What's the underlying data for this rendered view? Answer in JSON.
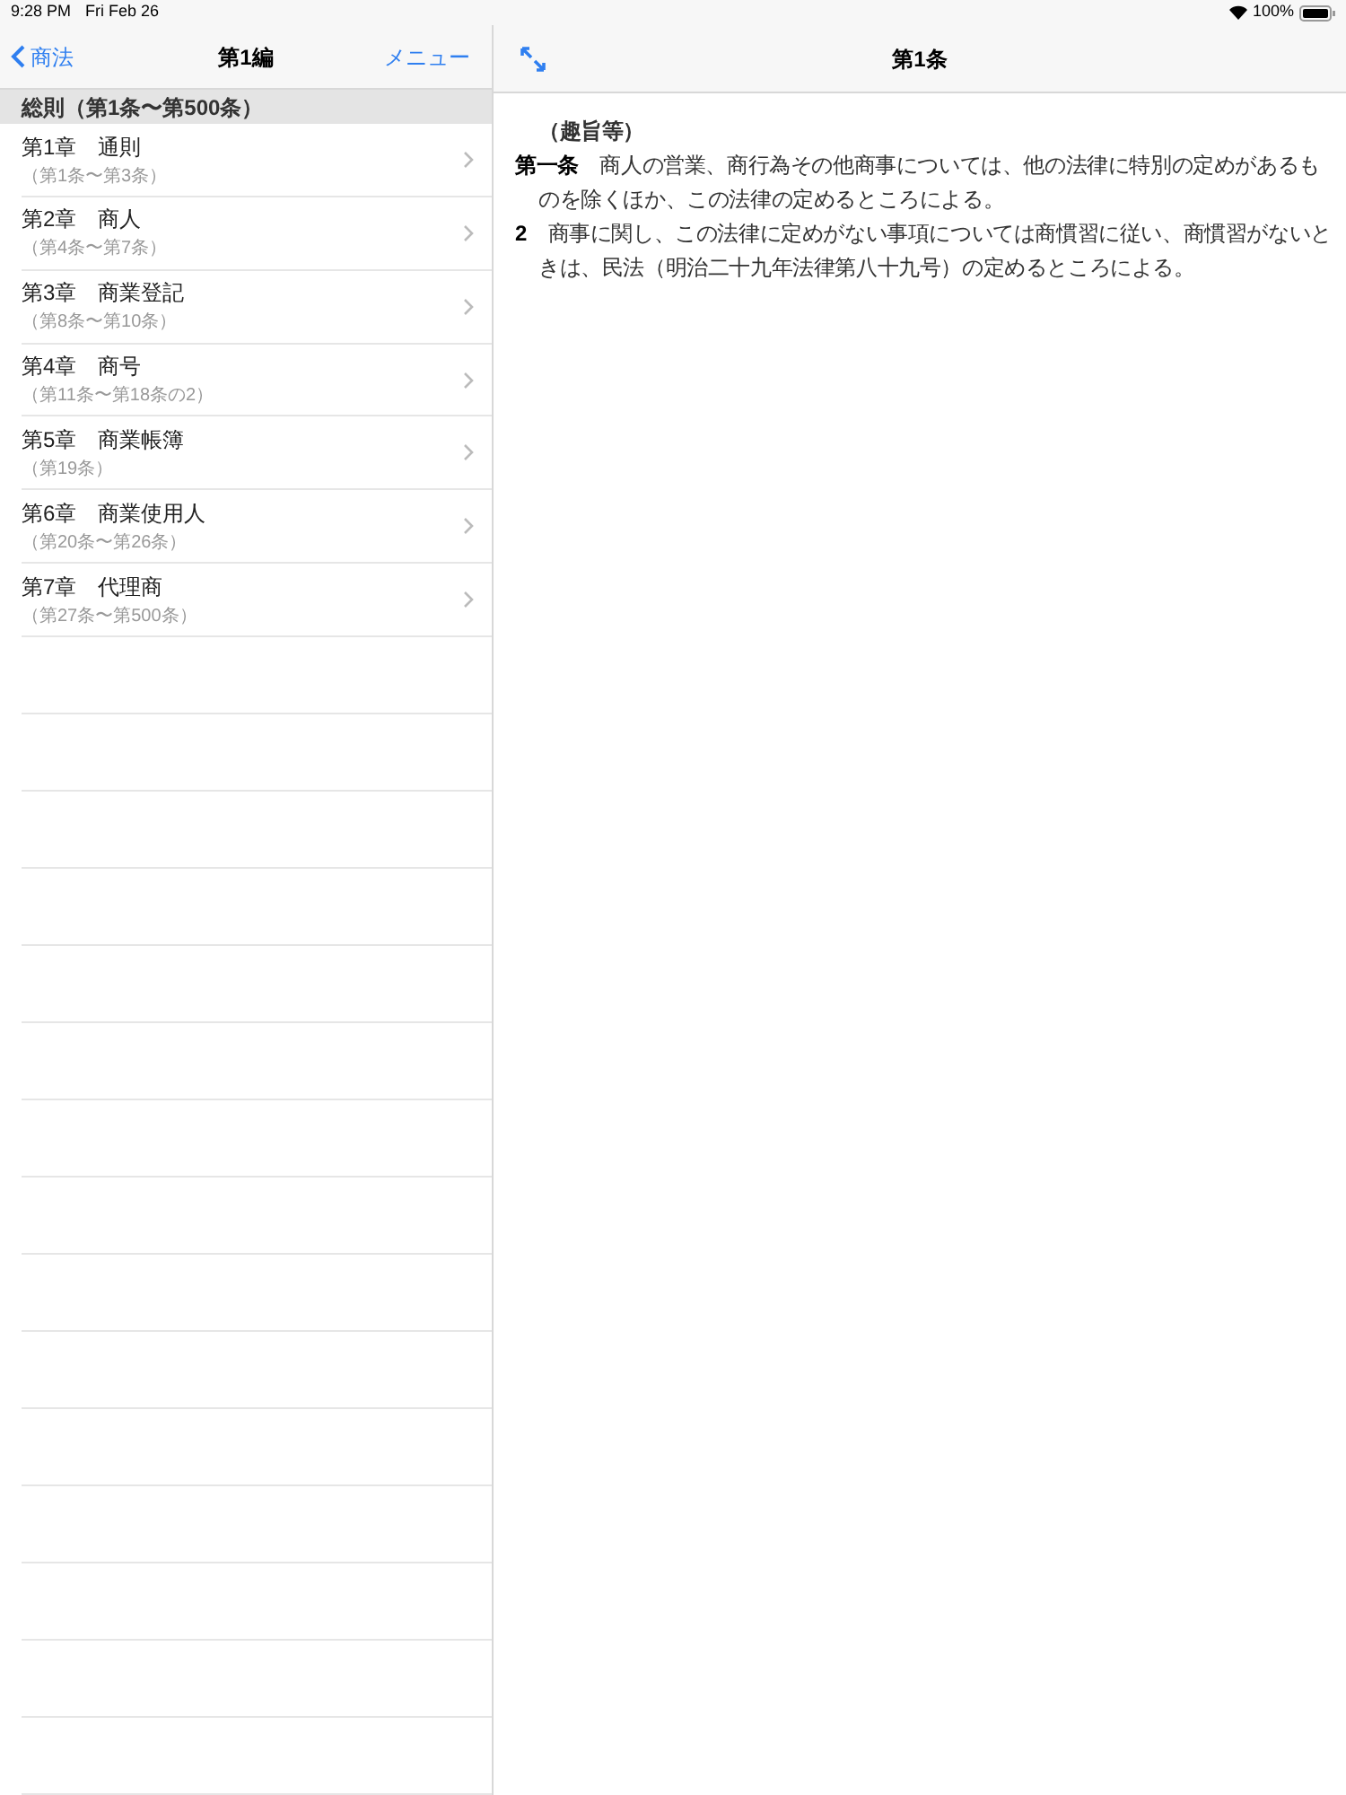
{
  "status_bar": {
    "time": "9:28 PM",
    "date": "Fri Feb 26",
    "battery_text": "100%"
  },
  "left_nav": {
    "back": "商法",
    "title": "第1編",
    "menu": "メニュー"
  },
  "section": {
    "title": "総則（第1条〜第500条）"
  },
  "chapters": [
    {
      "title": "第1章　通則",
      "range": "（第1条〜第3条）"
    },
    {
      "title": "第2章　商人",
      "range": "（第4条〜第7条）"
    },
    {
      "title": "第3章　商業登記",
      "range": "（第8条〜第10条）"
    },
    {
      "title": "第4章　商号",
      "range": "（第11条〜第18条の2）"
    },
    {
      "title": "第5章　商業帳簿",
      "range": "（第19条）"
    },
    {
      "title": "第6章　商業使用人",
      "range": "（第20条〜第26条）"
    },
    {
      "title": "第7章　代理商",
      "range": "（第27条〜第500条）"
    }
  ],
  "right_nav": {
    "title": "第1条"
  },
  "article": {
    "caption": "（趣旨等）",
    "paragraphs": [
      {
        "number": "第一条",
        "text": "商人の営業、商行為その他商事については、他の法律に特別の定めがあるものを除くほか、この法律の定めるところによる。"
      },
      {
        "number": "2",
        "text": "商事に関し、この法律に定めがない事項については商慣習に従い、商慣習がないときは、民法（明治二十九年法律第八十九号）の定めるところによる。"
      }
    ]
  }
}
